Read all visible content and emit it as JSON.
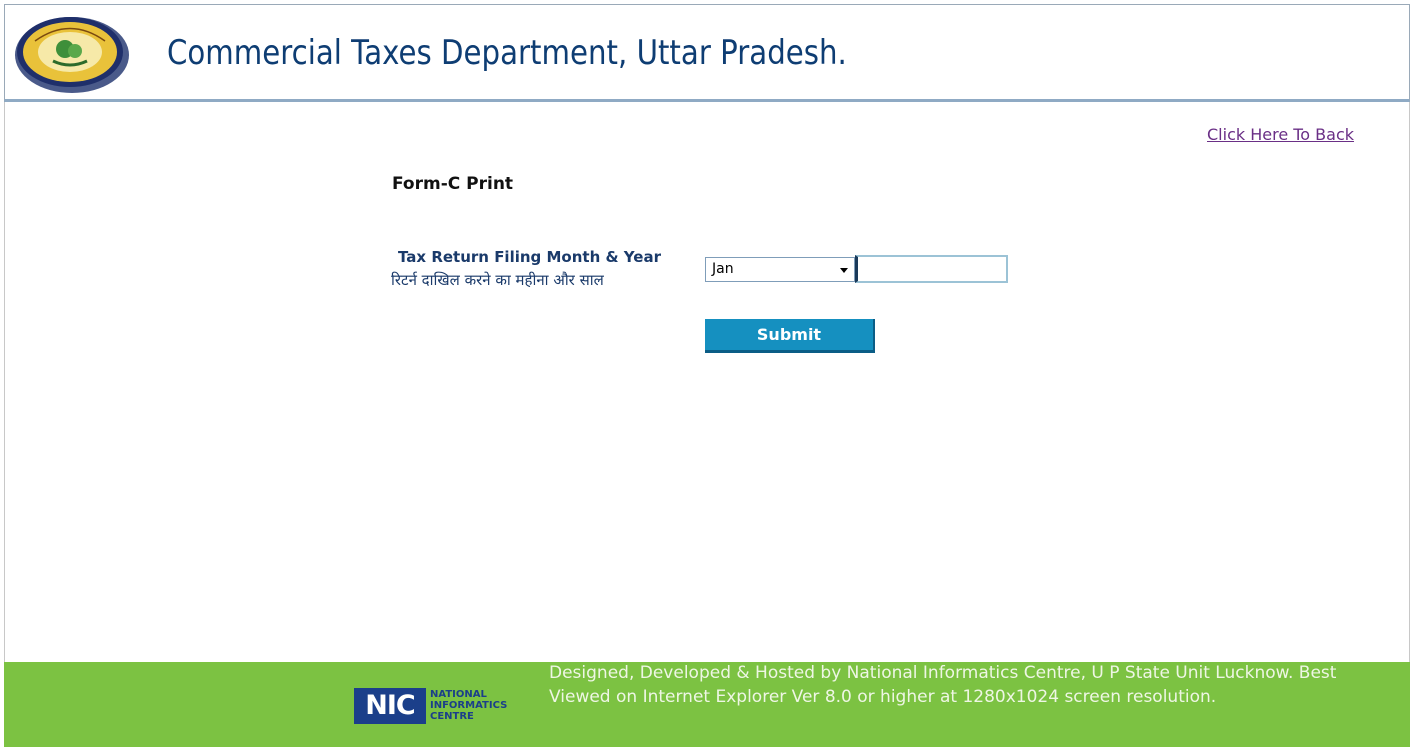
{
  "header": {
    "title": "Commercial Taxes Department, Uttar Pradesh.",
    "logo_icon": "department-seal-icon"
  },
  "nav": {
    "back_link": "Click Here To Back"
  },
  "form": {
    "title": "Form-C Print",
    "label_en": "Tax Return Filing Month & Year",
    "label_hi": "रिटर्न दाखिल करने का महीना और साल",
    "month_selected": "Jan",
    "year_value": "",
    "submit_label": "Submit"
  },
  "footer": {
    "nic_short": "NIC",
    "nic_line1": "NATIONAL",
    "nic_line2": "INFORMATICS",
    "nic_line3": "CENTRE",
    "text": "Designed, Developed & Hosted by National Informatics Centre, U P State Unit Lucknow. Best Viewed on Internet Explorer Ver 8.0 or higher at 1280x1024 screen resolution."
  },
  "colors": {
    "title": "#0e3d73",
    "submit_bg": "#1590c0",
    "footer_bg": "#7cc242",
    "link": "#6a2f86"
  }
}
